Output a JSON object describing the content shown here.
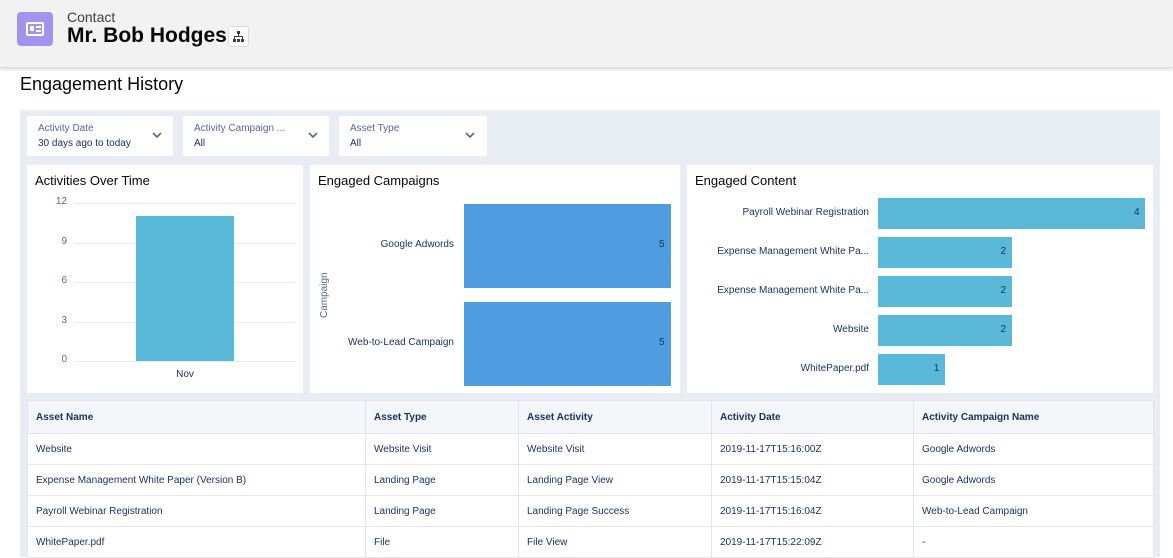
{
  "header": {
    "object_label": "Contact",
    "record_name": "Mr. Bob Hodges",
    "hierarchy_icon": "hierarchy-icon",
    "contact_icon": "contact-card-icon",
    "icon_color": "#a094ed"
  },
  "section": {
    "title": "Engagement History"
  },
  "filters": [
    {
      "label": "Activity Date",
      "value": "30 days ago to today"
    },
    {
      "label": "Activity Campaign ...",
      "value": "All"
    },
    {
      "label": "Asset Type",
      "value": "All"
    }
  ],
  "cards": {
    "activities": {
      "title": "Activities Over Time"
    },
    "campaigns": {
      "title": "Engaged Campaigns",
      "axis_title": "Campaign"
    },
    "content": {
      "title": "Engaged Content"
    }
  },
  "chart_data": [
    {
      "type": "bar",
      "title": "Activities Over Time",
      "categories": [
        "Nov"
      ],
      "values": [
        11
      ],
      "ylim": [
        0,
        12
      ],
      "yticks": [
        "12",
        "9",
        "6",
        "3",
        "0"
      ],
      "color": "#5ab8d8"
    },
    {
      "type": "bar",
      "orientation": "horizontal",
      "title": "Engaged Campaigns",
      "ylabel": "Campaign",
      "categories": [
        "Google Adwords",
        "Web-to-Lead Campaign"
      ],
      "values": [
        5,
        5
      ],
      "color": "#4f9de0"
    },
    {
      "type": "bar",
      "orientation": "horizontal",
      "title": "Engaged Content",
      "categories": [
        "Payroll Webinar Registration",
        "Expense Management White Pa...",
        "Expense Management White Pa...",
        "Website",
        "WhitePaper.pdf"
      ],
      "values": [
        4,
        2,
        2,
        2,
        1
      ],
      "color": "#5ab8d8"
    }
  ],
  "table": {
    "columns": [
      "Asset Name",
      "Asset Type",
      "Asset Activity",
      "Activity Date",
      "Activity Campaign Name"
    ],
    "rows": [
      [
        "Website",
        "Website Visit",
        "Website Visit",
        "2019-11-17T15:16:00Z",
        "Google Adwords"
      ],
      [
        "Expense Management White Paper (Version B)",
        "Landing Page",
        "Landing Page View",
        "2019-11-17T15:15:04Z",
        "Google Adwords"
      ],
      [
        "Payroll Webinar Registration",
        "Landing Page",
        "Landing Page Success",
        "2019-11-17T15:16:04Z",
        "Web-to-Lead Campaign"
      ],
      [
        "WhitePaper.pdf",
        "File",
        "File View",
        "2019-11-17T15:22:09Z",
        "-"
      ]
    ]
  }
}
